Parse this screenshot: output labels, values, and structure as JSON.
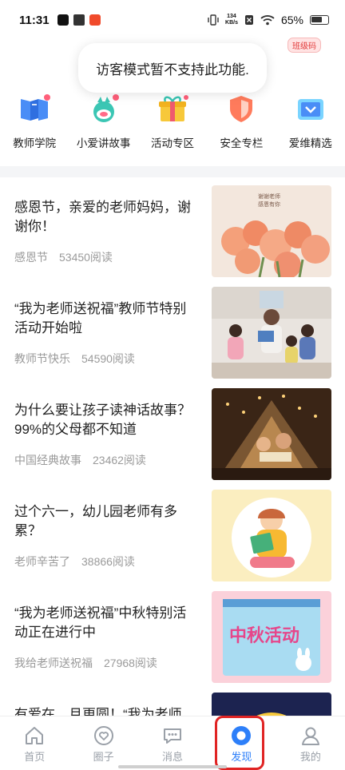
{
  "status_bar": {
    "time": "11:31",
    "net_speed_value": "134",
    "net_speed_unit": "KB/s",
    "battery": "65%"
  },
  "toast": {
    "message": "访客模式暂不支持此功能."
  },
  "class_badge": "班级码",
  "quick_links": [
    {
      "label": "教师学院",
      "icon": "book-icon"
    },
    {
      "label": "小爱讲故事",
      "icon": "mascot-icon"
    },
    {
      "label": "活动专区",
      "icon": "gift-icon"
    },
    {
      "label": "安全专栏",
      "icon": "shield-icon"
    },
    {
      "label": "爱维精选",
      "icon": "tv-icon"
    }
  ],
  "feed": [
    {
      "title": "感恩节，亲爱的老师妈妈，谢谢你！",
      "tag": "感恩节",
      "reads": "53450阅读",
      "thumb_text": "谢谢老师\n感恩有你"
    },
    {
      "title": "“我为老师送祝福”教师节特别活动开始啦",
      "tag": "教师节快乐",
      "reads": "54590阅读",
      "thumb_text": ""
    },
    {
      "title": "为什么要让孩子读神话故事？99%的父母都不知道",
      "tag": "中国经典故事",
      "reads": "23462阅读",
      "thumb_text": ""
    },
    {
      "title": "过个六一，幼儿园老师有多累？",
      "tag": "老师辛苦了",
      "reads": "38866阅读",
      "thumb_text": ""
    },
    {
      "title": "“我为老师送祝福”中秋特别活动正在进行中",
      "tag": "我给老师送祝福",
      "reads": "27968阅读",
      "thumb_text": "中秋活动"
    },
    {
      "title": "有爱在，月更圆！“我为老师",
      "tag": "",
      "reads": "",
      "thumb_text": ""
    }
  ],
  "tabbar": {
    "items": [
      {
        "label": "首页",
        "icon": "home-icon",
        "active": false
      },
      {
        "label": "圈子",
        "icon": "heart-icon",
        "active": false
      },
      {
        "label": "消息",
        "icon": "message-icon",
        "active": false
      },
      {
        "label": "发现",
        "icon": "discover-icon",
        "active": true
      },
      {
        "label": "我的",
        "icon": "profile-icon",
        "active": false
      }
    ]
  },
  "colors": {
    "accent": "#2d7ff9",
    "highlight": "#e02424",
    "muted": "#9a9a9a"
  }
}
